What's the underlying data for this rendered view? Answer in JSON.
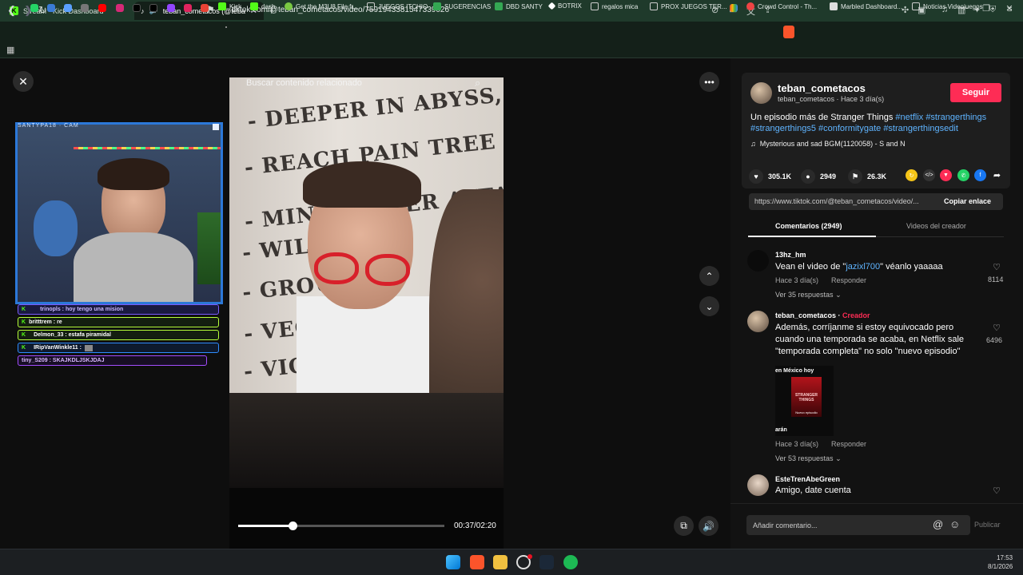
{
  "browser": {
    "tabs": [
      {
        "title": "Stream - Kick Dashboard",
        "active": false
      },
      {
        "title": "teban_cometacos (@teban_co",
        "active": true
      }
    ],
    "url": "tiktok.com/@teban_cometacos/video/7591943381547339026",
    "bookmarks": [
      "Kick",
      "dash",
      "Get the M3U8 File fr...",
      "JUEGOS ITCHIO",
      "SUGERENCIAS",
      "DBD SANTY",
      "BOTRIX",
      "regalos mica",
      "PROX JUEGOS TER...",
      "Crowd Control - Th...",
      "Marbled Dashboard...",
      "Noticias Videojuegos"
    ]
  },
  "player": {
    "search_placeholder": "Buscar contenido relacionado",
    "time": "00:37/02:20",
    "progress": 0.264,
    "whiteboard_lines": [
      "- DEEPER IN ABYSS,",
      "- REACH PAIN TREE IT",
      "- MIND FLAYER ATTACKS,",
      "- WILL",
      "- GROUP",
      "- VECNA",
      "- VIC"
    ]
  },
  "stream_overlay": {
    "cam_label": "SANTYPA18 · CAM",
    "chat": [
      {
        "user": "trinopls",
        "text": "trinopls : hoy tengo una mision",
        "color": "#7b5cff"
      },
      {
        "user": "britttrem",
        "text": "britttrem : re",
        "color": "#b6ff3a"
      },
      {
        "user": "Delmon_33",
        "text": "Delmon_33 : estafa piramidal",
        "color": "#b6ff3a"
      },
      {
        "user": "IRipVanWinkle11",
        "text": "IRipVanWinkle11 :",
        "color": "#2f8cff"
      },
      {
        "user": "tiny_S209",
        "text": "tiny_S209 : SKAJKDLJSKJDAJ",
        "color": "#a34dff"
      }
    ]
  },
  "post": {
    "author": "teban_cometacos",
    "author_sub": "teban_cometacos · Hace 3 día(s)",
    "follow_label": "Seguir",
    "desc_text": "Un episodio más de Stranger Things",
    "hashtags_line1": "#netflix #strangerthings",
    "hashtags_line2": "#strangerthings5 #conformitygate #strangerthingsedit",
    "music": "Mysterious and sad BGM(1120058) - S and N",
    "likes": "305.1K",
    "comments_count": "2949",
    "saves": "26.3K",
    "link": "https://www.tiktok.com/@teban_cometacos/video/...",
    "copy_label": "Copiar enlace",
    "tab_comments": "Comentarios (2949)",
    "tab_creator": "Videos del creador"
  },
  "comments": [
    {
      "user": "13hz_hm",
      "text_pre": "Vean el video de \"",
      "mention": "jazixl700",
      "text_post": "\" véanlo yaaaaa",
      "date": "Hace 3 día(s)",
      "reply": "Responder",
      "likes": "8114",
      "replies": "Ver 35 respuestas"
    },
    {
      "user": "teban_cometacos",
      "creator": "Creador",
      "text": "Además, corríjanme si estoy equivocado pero cuando una temporada se acaba, en Netflix sale \"temporada completa\" no solo \"nuevo episodio\"",
      "date": "Hace 3 día(s)",
      "reply": "Responder",
      "likes": "6496",
      "replies": "Ver 53 respuestas",
      "img_top": "en México hoy",
      "img_bottom": "arán",
      "img_title": "STRANGER THINGS",
      "img_badge": "Nuevo episodio"
    },
    {
      "user": "EsteTrenAbeGreen",
      "text": "Amigo, date cuenta"
    }
  ],
  "comment_input_placeholder": "Añadir comentario...",
  "publish_label": "Publicar",
  "clock": {
    "time": "17:53",
    "date": "8/1/2026"
  }
}
